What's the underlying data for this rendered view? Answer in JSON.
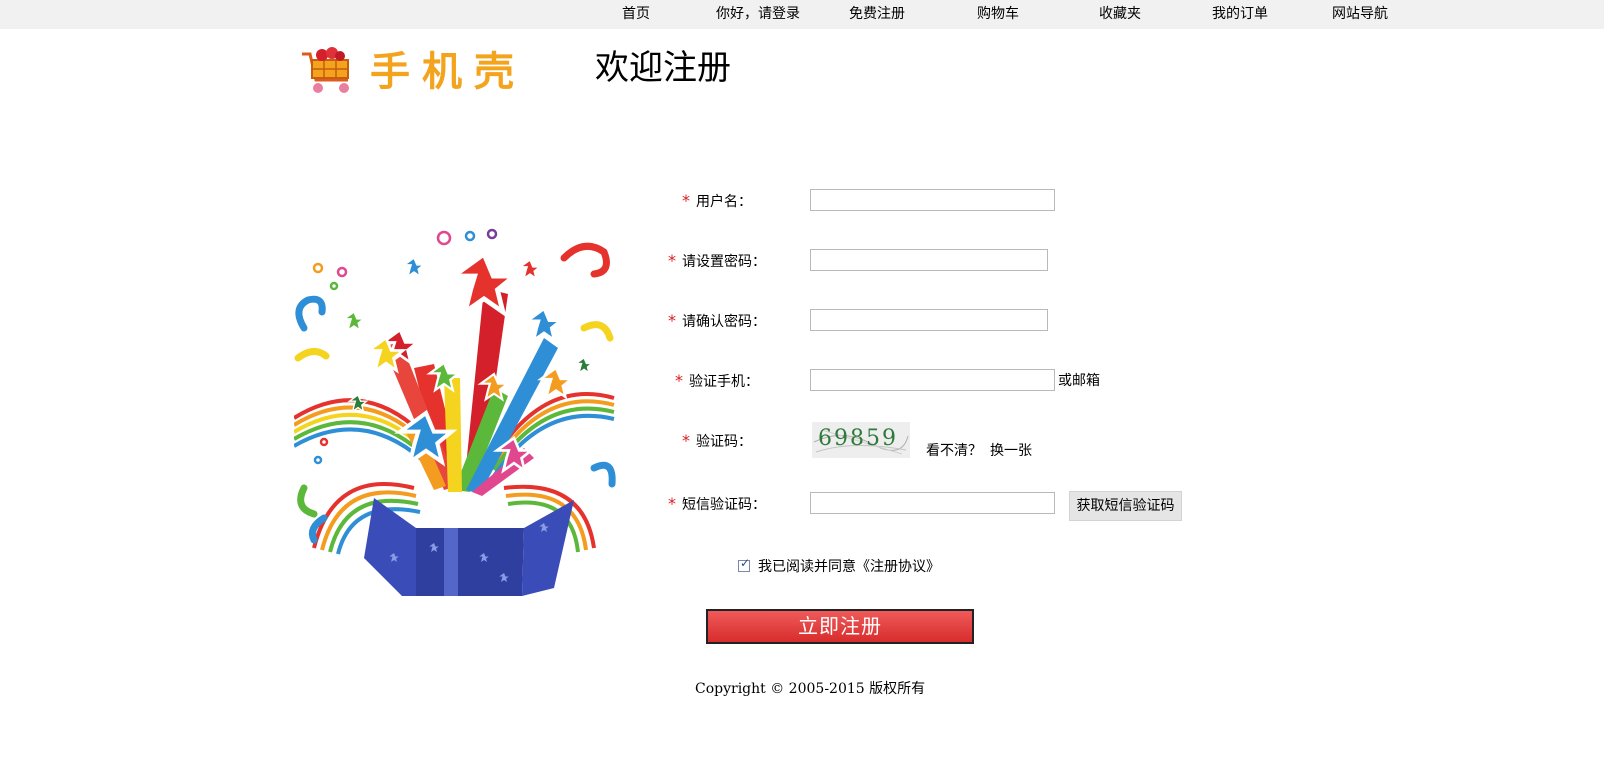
{
  "nav": {
    "items": [
      "首页",
      "你好，请登录",
      "免费注册",
      "购物车",
      "收藏夹",
      "我的订单",
      "网站导航"
    ]
  },
  "logo": {
    "text": "手机壳"
  },
  "page": {
    "title": "欢迎注册"
  },
  "form": {
    "username_label": "用户名：",
    "password_label": "请设置密码：",
    "confirm_label": "请确认密码：",
    "phone_label": "验证手机：",
    "phone_alt": "或邮箱",
    "captcha_label": "验证码：",
    "captcha_text": "69859",
    "captcha_unclear": "看不清？",
    "captcha_refresh": "换一张",
    "sms_label": "短信验证码：",
    "sms_button": "获取短信验证码",
    "required_mark": "*",
    "username_value": "",
    "password_value": "",
    "confirm_value": "",
    "phone_value": "",
    "sms_value": ""
  },
  "agreement": {
    "text": "我已阅读并同意《注册协议》",
    "checked": true
  },
  "submit": {
    "label": "立即注册"
  },
  "footer": {
    "copyright": "Copyright © 2005-2015 版权所有"
  },
  "colors": {
    "required": "#d91d1d",
    "submit": "#e03a3a",
    "topbar": "#f1f1f1",
    "logo": "#f3a31c"
  }
}
